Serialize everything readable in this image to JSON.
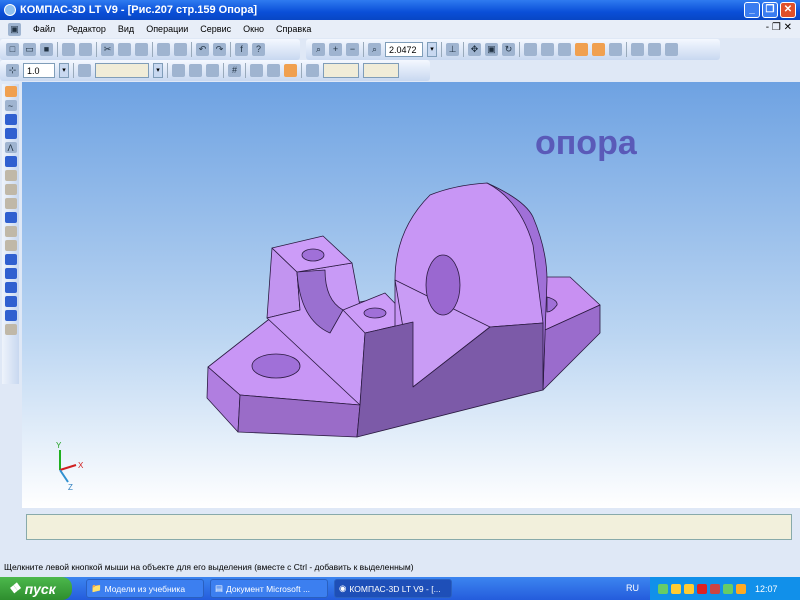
{
  "window": {
    "title": "КОМПАС-3D LT V9 - [Рис.207  стр.159  Опора]",
    "minimize": "_",
    "restore": "❐",
    "close": "✕"
  },
  "menu": [
    "Файл",
    "Редактор",
    "Вид",
    "Операции",
    "Сервис",
    "Окно",
    "Справка"
  ],
  "mdi_controls": "- ❐ ✕",
  "toolbar": {
    "zoom_value": "2.0472",
    "step_value": "1.0"
  },
  "viewport": {
    "label": "опора",
    "axes": {
      "x": "X",
      "y": "Y",
      "z": "Z"
    },
    "model_color": "#c896f5"
  },
  "status_text": "Щелкните левой кнопкой мыши на объекте для его выделения (вместе с Ctrl - добавить к выделенным)",
  "taskbar": {
    "start": "пуск",
    "tasks": [
      "Модели  из  учебника",
      "Документ Microsoft ...",
      "КОМПАС-3D LT V9 - [..."
    ],
    "lang": "RU",
    "clock": "12:07"
  }
}
